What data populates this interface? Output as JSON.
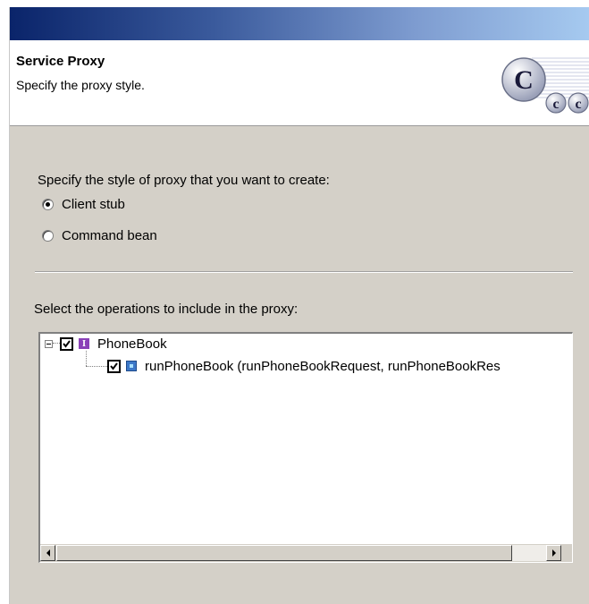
{
  "header": {
    "title": "Service Proxy",
    "description": "Specify the proxy style.",
    "logo_icon": "cics-c-logo-icon",
    "logo_letters": [
      "C",
      "c",
      "c"
    ]
  },
  "style": {
    "label": "Specify the style of proxy that you want to create:",
    "options": [
      {
        "label": "Client stub",
        "selected": true
      },
      {
        "label": "Command bean",
        "selected": false
      }
    ]
  },
  "operations": {
    "label": "Select the operations to include in the proxy:",
    "tree": [
      {
        "label": "PhoneBook",
        "icon": "interface-icon",
        "icon_letter": "I",
        "checked": true,
        "expanded": true,
        "level": 0
      },
      {
        "label": "runPhoneBook (runPhoneBookRequest, runPhoneBookRes",
        "icon": "operation-icon",
        "checked": true,
        "level": 1
      }
    ]
  },
  "colors": {
    "titlebar_start": "#0a246a",
    "titlebar_end": "#a6caf0",
    "panel_bg": "#d4d0c8",
    "interface_icon": "#8a40b8",
    "operation_icon": "#3c78c8"
  }
}
